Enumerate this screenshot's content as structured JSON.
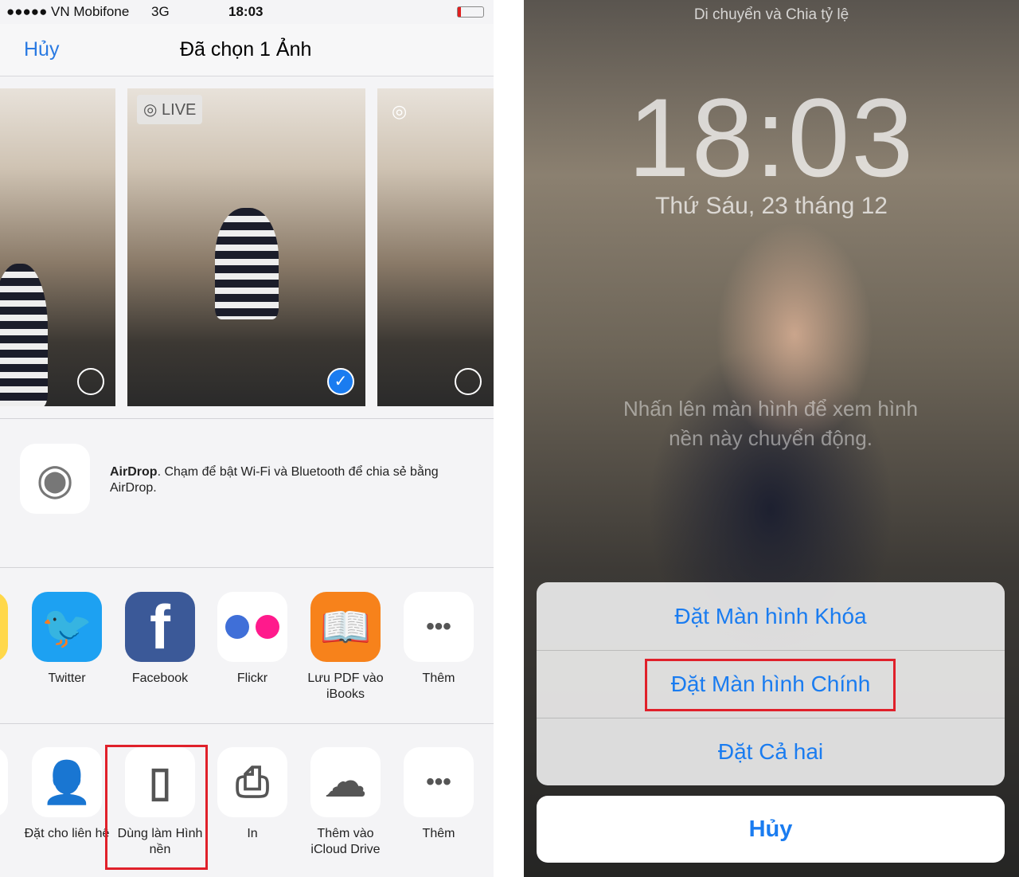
{
  "left": {
    "status": {
      "signal": "●●●●●",
      "carrier": "VN Mobifone",
      "network": "3G",
      "time": "18:03",
      "battery_level": 0.1
    },
    "nav": {
      "cancel": "Hủy",
      "title": "Đã chọn 1 Ảnh"
    },
    "photos": [
      {
        "selected": false
      },
      {
        "selected": true,
        "badge": "LIVE"
      },
      {
        "selected": false
      }
    ],
    "airdrop": {
      "title": "AirDrop",
      "text": ". Chạm để bật Wi-Fi và Bluetooth để chia sẻ bằng AirDrop."
    },
    "apps": [
      {
        "label": "Twitter",
        "icon": "twitter-icon",
        "color": "#1da1f2"
      },
      {
        "label": "Facebook",
        "icon": "facebook-icon",
        "color": "#3b5998"
      },
      {
        "label": "Flickr",
        "icon": "flickr-icon"
      },
      {
        "label": "Lưu PDF vào iBooks",
        "icon": "ibooks-icon",
        "color": "#f7821b"
      },
      {
        "label": "Thêm",
        "icon": "more-icon"
      }
    ],
    "actions": [
      {
        "label": "Đặt cho liên hệ",
        "icon": "contact-icon"
      },
      {
        "label": "Dùng làm Hình nền",
        "icon": "phone-icon",
        "highlighted": true
      },
      {
        "label": "In",
        "icon": "printer-icon"
      },
      {
        "label": "Thêm vào iCloud Drive",
        "icon": "icloud-upload-icon"
      },
      {
        "label": "Thêm",
        "icon": "more-icon"
      }
    ]
  },
  "right": {
    "top_label": "Di chuyển và Chia tỷ lệ",
    "time": "18:03",
    "date": "Thứ Sáu, 23 tháng 12",
    "hint": "Nhấn lên màn hình để xem hình nền này chuyển động.",
    "sheet": {
      "options": [
        "Đặt Màn hình Khóa",
        "Đặt Màn hình Chính",
        "Đặt Cả hai"
      ],
      "highlighted": "Đặt Màn hình Chính",
      "cancel": "Hủy"
    }
  }
}
